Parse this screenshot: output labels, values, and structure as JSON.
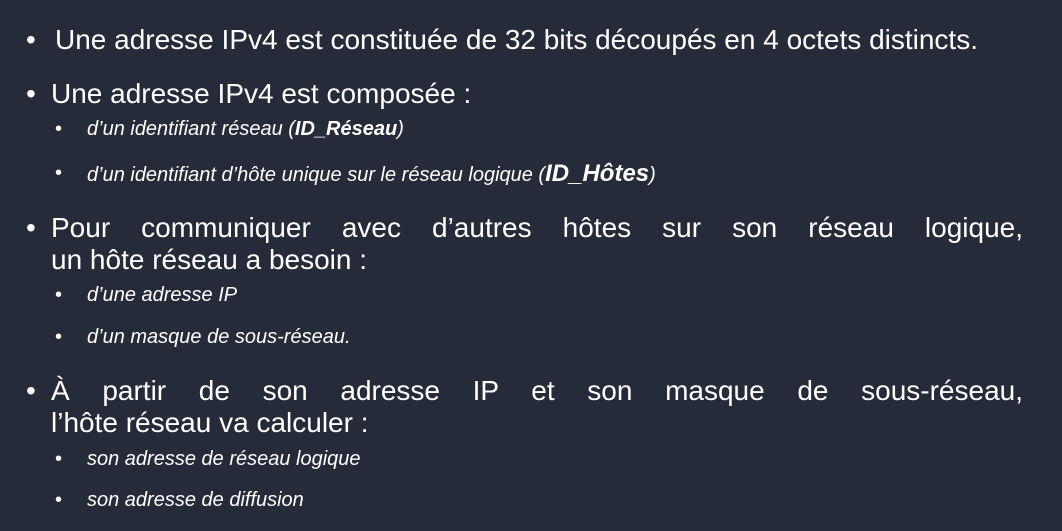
{
  "bullets": [
    {
      "text": "Une adresse IPv4 est constituée de 32 bits découpés en 4 octets distincts."
    },
    {
      "text": "Une adresse IPv4 est composée :",
      "subs": [
        {
          "pre": "d’un identifiant réseau (",
          "bold": "ID_Réseau",
          "post": ")"
        },
        {
          "pre": "d’un identifiant d’hôte unique sur le réseau logique (",
          "bold": "ID_Hôtes",
          "post": ")"
        }
      ]
    },
    {
      "line1": "Pour communiquer avec d’autres hôtes sur son réseau logique,",
      "line2": "un hôte réseau a besoin :",
      "subs": [
        {
          "text": "d’une adresse IP"
        },
        {
          "text": "d’un masque de sous-réseau."
        }
      ]
    },
    {
      "line1": "À partir de son adresse IP et son masque de sous-réseau,",
      "line2": "l’hôte réseau va calculer :",
      "subs": [
        {
          "text": "son adresse de réseau logique"
        },
        {
          "text": "son adresse de diffusion"
        }
      ]
    }
  ],
  "bullet_glyph": "•"
}
